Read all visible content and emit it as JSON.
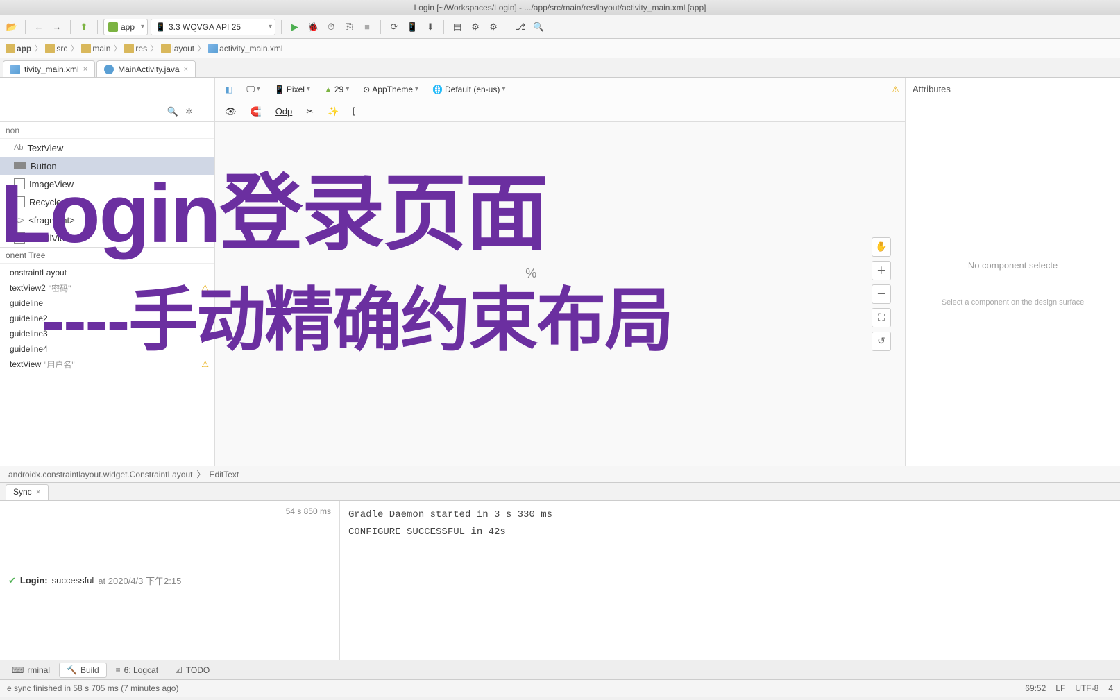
{
  "titlebar": "Login [~/Workspaces/Login] - .../app/src/main/res/layout/activity_main.xml [app]",
  "toolbar": {
    "run_config": "app",
    "device": "3.3  WQVGA API 25"
  },
  "breadcrumb": [
    "app",
    "src",
    "main",
    "res",
    "layout",
    "activity_main.xml"
  ],
  "editor_tabs": [
    {
      "label": "tivity_main.xml",
      "icon": "xml"
    },
    {
      "label": "MainActivity.java",
      "icon": "java"
    }
  ],
  "palette": {
    "category": "non",
    "items": [
      {
        "label": "TextView",
        "prefix": "Ab"
      },
      {
        "label": "Button",
        "selected": true
      },
      {
        "label": "ImageView"
      },
      {
        "label": "RecyclerView"
      },
      {
        "label": "<fragment>"
      },
      {
        "label": "ScrollView"
      }
    ]
  },
  "tree": {
    "title": "onent Tree",
    "items": [
      {
        "label": "onstraintLayout"
      },
      {
        "label": "textView2",
        "extra": "\"密码\"",
        "warn": true
      },
      {
        "label": "guideline"
      },
      {
        "label": "guideline2"
      },
      {
        "label": "guideline3"
      },
      {
        "label": "guideline4"
      },
      {
        "label": "textView",
        "extra": "\"用户名\"",
        "warn": true
      }
    ]
  },
  "design_toolbar": {
    "device": "Pixel",
    "api": "29",
    "theme": "AppTheme",
    "locale": "Default (en-us)",
    "zoom_label": "Odp"
  },
  "attributes": {
    "title": "Attributes",
    "empty": "No component selecte",
    "hint": "Select a component on the design surface"
  },
  "canvas": {
    "center": "%"
  },
  "bottom_breadcrumb": [
    "androidx.constraintlayout.widget.ConstraintLayout",
    "EditText"
  ],
  "sync": {
    "tab": "Sync",
    "status_prefix": "Login:",
    "status_word": "successful",
    "status_at": "at 2020/4/3 下午2:15",
    "duration": "54 s 850 ms",
    "console": [
      "Gradle Daemon started in 3 s 330 ms",
      "",
      "CONFIGURE SUCCESSFUL in 42s"
    ]
  },
  "bottom_tabs": [
    "rminal",
    "Build",
    "6: Logcat",
    "TODO"
  ],
  "statusbar": {
    "msg": "e sync finished in 58 s 705 ms (7 minutes ago)",
    "pos": "69:52",
    "le": "LF",
    "enc": "UTF-8",
    "sp": "4"
  },
  "overlay": {
    "line1": "Login登录页面",
    "line2": "----手动精确约束布局"
  }
}
